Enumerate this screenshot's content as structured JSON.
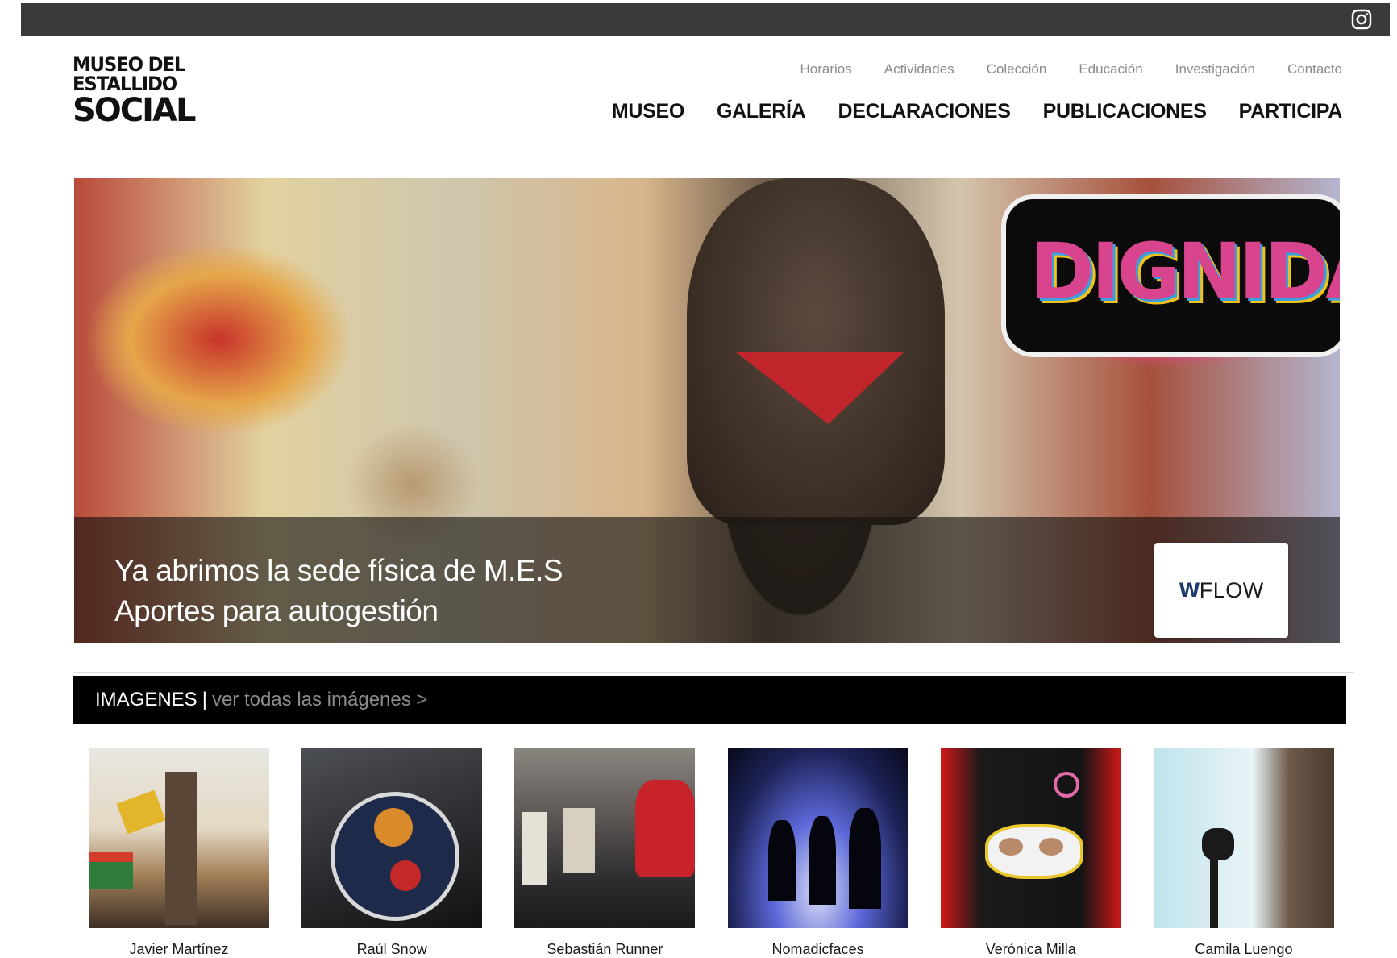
{
  "topbar": {
    "social_icon": "instagram-icon"
  },
  "logo": {
    "line1": "MUSEO DEL",
    "line2": "ESTALLIDO",
    "line3": "SOCIAL"
  },
  "secondary_nav": [
    "Horarios",
    "Actividades",
    "Colección",
    "Educación",
    "Investigación",
    "Contacto"
  ],
  "main_nav": [
    "MUSEO",
    "GALERÍA",
    "DECLARACIONES",
    "PUBLICACIONES",
    "PARTICIPA"
  ],
  "hero": {
    "mural_text": "DIGNIDAD",
    "line1": "Ya abrimos la sede física de M.E.S",
    "line2": "Aportes para autogestión",
    "badge": {
      "mark": "W",
      "text": "FLOW"
    }
  },
  "images_section": {
    "title": "IMAGENES",
    "separator": "|",
    "link": "ver todas las imágenes >",
    "items": [
      {
        "caption": "Javier Martínez"
      },
      {
        "caption": "Raúl Snow"
      },
      {
        "caption": "Sebastián Runner"
      },
      {
        "caption": "Nomadicfaces"
      },
      {
        "caption": "Verónica Milla"
      },
      {
        "caption": "Camila Luengo"
      }
    ]
  },
  "colors": {
    "topbar": "#3a3a3a",
    "section_bar": "#000000",
    "link_grey": "#8b8b8b"
  }
}
